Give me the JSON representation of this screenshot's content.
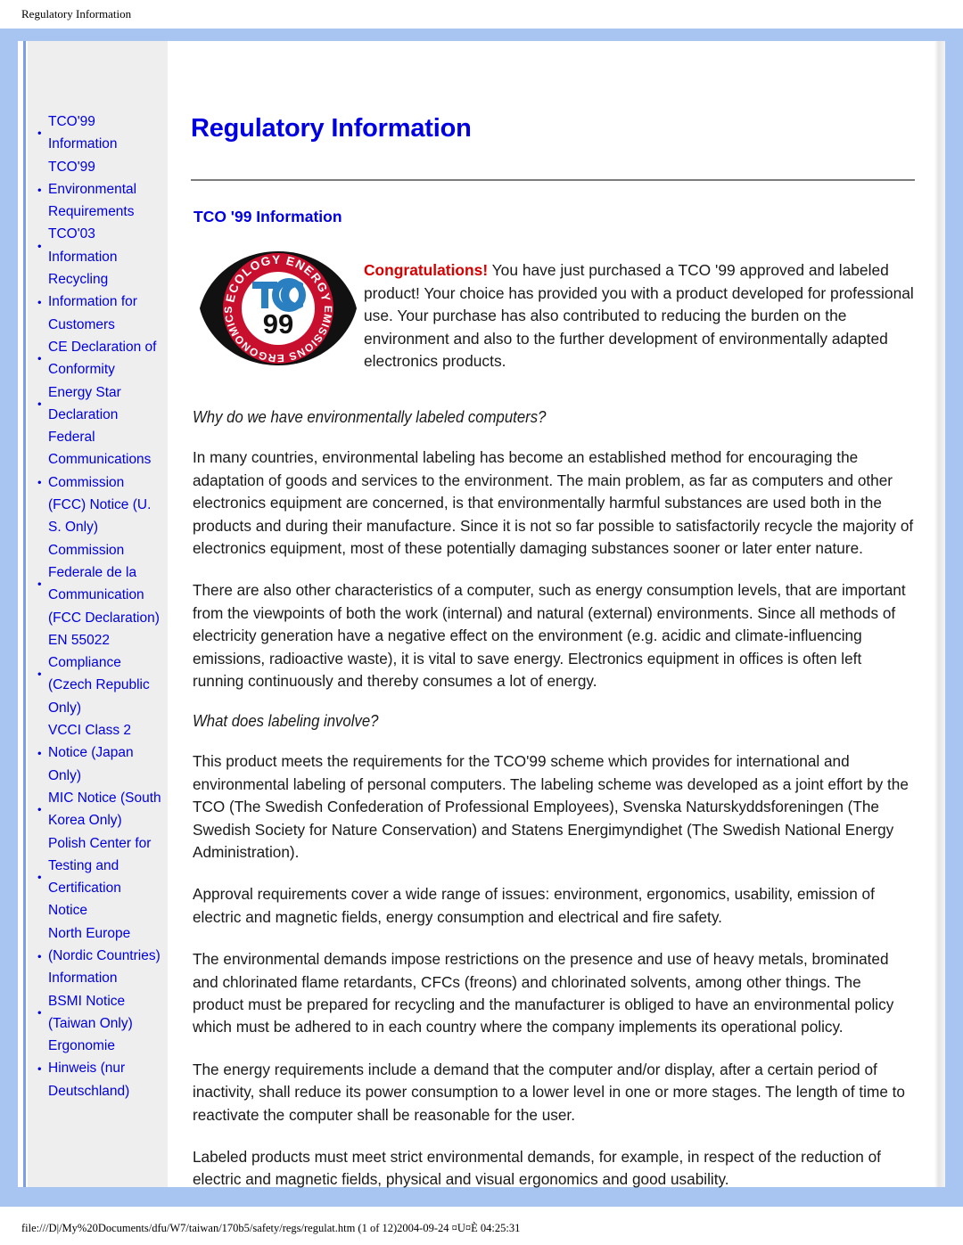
{
  "print_header": "Regulatory Information",
  "print_footer": "file:///D|/My%20Documents/dfu/W7/taiwan/170b5/safety/regs/regulat.htm (1 of 12)2004-09-24 ¤U¤È 04:25:31",
  "colors": {
    "frame": "#a8c4f0",
    "link": "#0000dd",
    "title": "#0000e0",
    "congrats": "#d60000",
    "sidebar_bg": "#eeeeee",
    "rule": "#7c7c7c",
    "logo_red": "#c8102e",
    "logo_blue": "#2a7fc1",
    "logo_black": "#1a1a1a"
  },
  "sidebar": {
    "items": [
      {
        "label": "TCO'99 Information"
      },
      {
        "label": "TCO'99 Environmental Requirements"
      },
      {
        "label": "TCO'03 Information"
      },
      {
        "label": "Recycling Information for Customers"
      },
      {
        "label": "CE Declaration of Conformity"
      },
      {
        "label": "Energy Star Declaration"
      },
      {
        "label": "Federal Communications Commission (FCC) Notice (U. S. Only)"
      },
      {
        "label": "Commission Federale de la Communication (FCC Declaration)"
      },
      {
        "label": "EN 55022 Compliance (Czech Republic Only)"
      },
      {
        "label": "VCCI Class 2 Notice (Japan Only)"
      },
      {
        "label": "MIC Notice (South Korea Only)"
      },
      {
        "label": "Polish Center for Testing and Certification Notice"
      },
      {
        "label": "North Europe (Nordic Countries) Information"
      },
      {
        "label": "BSMI Notice (Taiwan Only)"
      },
      {
        "label": "Ergonomie Hinweis (nur Deutschland)"
      }
    ]
  },
  "main": {
    "page_title": "Regulatory Information",
    "section_title": "TCO '99 Information",
    "logo": {
      "top_arc_text": "ECOLOGY ENERGY",
      "bottom_arc_text": "EMISSIONS ERGONOMICS",
      "center_text": "TCO",
      "year_text": "99"
    },
    "intro_bold": "Congratulations!",
    "intro_rest": " You have just purchased a TCO '99 approved and labeled product! Your choice has provided you with a product developed for professional use. Your purchase has also contributed to reducing the burden on the environment and also to the further development of environmentally adapted electronics products.",
    "heading_1": "Why do we have environmentally labeled computers?",
    "para_1": "In many countries, environmental labeling has become an established method for encouraging the adaptation of goods and services to the environment. The main problem, as far as computers and other electronics equipment are concerned, is that environmentally harmful substances are used both in the products and during their manufacture. Since it is not so far possible to satisfactorily recycle the majority of electronics equipment, most of these potentially damaging substances sooner or later enter nature.",
    "para_2": "There are also other characteristics of a computer, such as energy consumption levels, that are important from the viewpoints of both the work (internal) and natural (external) environments. Since all methods of electricity generation have a negative effect on the environment (e.g. acidic and climate-influencing emissions, radioactive waste), it is vital to save energy. Electronics equipment in offices is often left running continuously and thereby consumes a lot of energy.",
    "heading_2": "What does labeling involve?",
    "para_3": "This product meets the requirements for the TCO'99 scheme which provides for international and environmental labeling of personal computers. The labeling scheme was developed as a joint effort by the TCO (The Swedish Confederation of Professional Employees), Svenska Naturskyddsforeningen (The Swedish Society for Nature Conservation) and Statens Energimyndighet (The Swedish National Energy Administration).",
    "para_4": "Approval requirements cover a wide range of issues: environment, ergonomics, usability, emission of electric and magnetic fields, energy consumption and electrical and fire safety.",
    "para_5": "The environmental demands impose restrictions on the presence and use of heavy metals, brominated and chlorinated flame retardants, CFCs (freons) and chlorinated solvents, among other things. The product must be prepared for recycling and the manufacturer is obliged to have an environmental policy which must be adhered to in each country where the company implements its operational policy.",
    "para_6": "The energy requirements include a demand that the computer and/or display, after a certain period of inactivity, shall reduce its power consumption to a lower level in one or more stages. The length of time to reactivate the computer shall be reasonable for the user.",
    "para_7": "Labeled products must meet strict environmental demands, for example, in respect of the reduction of electric and magnetic fields, physical and visual ergonomics and good usability."
  }
}
